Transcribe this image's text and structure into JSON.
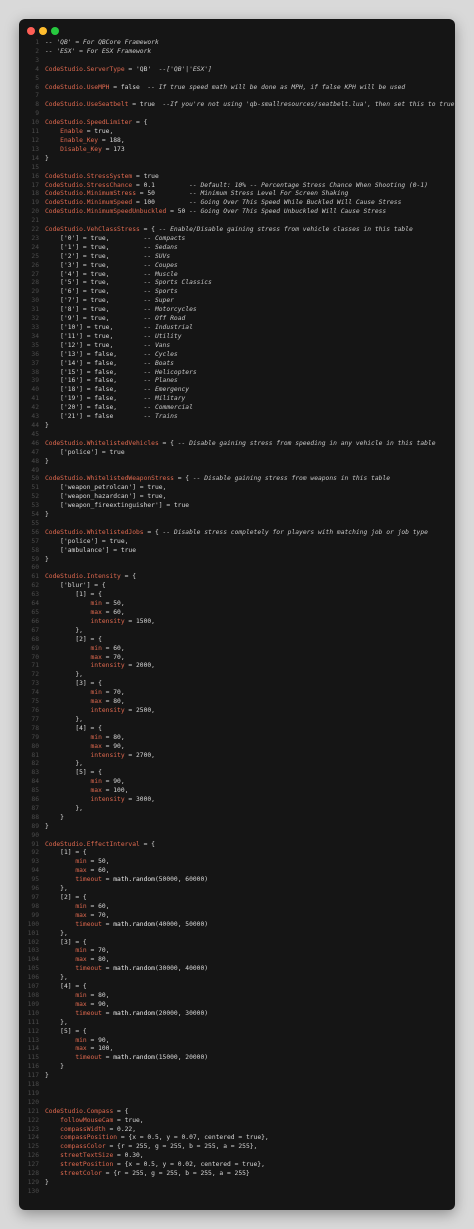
{
  "window_controls": [
    "close",
    "minimize",
    "maximize"
  ],
  "colors": {
    "keyword": "#e0694f",
    "comment": "#c8c8c8",
    "text": "#d8d8d8",
    "background": "#151515"
  },
  "code_lines": [
    [
      [
        "c",
        "-- 'QB' = For QBCore Framework"
      ]
    ],
    [
      [
        "c",
        "-- 'ESX' = For ESX Framework"
      ]
    ],
    [],
    [
      [
        "k",
        "CodeStudio.ServerType"
      ],
      [
        "t",
        " = 'QB'  "
      ],
      [
        "c",
        "--['QB'|'ESX']"
      ]
    ],
    [],
    [
      [
        "k",
        "CodeStudio.UseMPH"
      ],
      [
        "t",
        " = false  "
      ],
      [
        "c",
        "-- If true speed math will be done as MPH, if false KPH will be used"
      ]
    ],
    [],
    [
      [
        "k",
        "CodeStudio.UseSeatbelt"
      ],
      [
        "t",
        " = true  "
      ],
      [
        "c",
        "--If you're not using 'qb-smallresources/seatbelt.lua', then set this to true."
      ]
    ],
    [],
    [
      [
        "k",
        "CodeStudio.SpeedLimiter"
      ],
      [
        "t",
        " = {"
      ]
    ],
    [
      [
        "t",
        "    "
      ],
      [
        "k",
        "Enable"
      ],
      [
        "t",
        " = true,"
      ]
    ],
    [
      [
        "t",
        "    "
      ],
      [
        "k",
        "Enable_Key"
      ],
      [
        "t",
        " = 188,"
      ]
    ],
    [
      [
        "t",
        "    "
      ],
      [
        "k",
        "Disable_Key"
      ],
      [
        "t",
        " = 173"
      ]
    ],
    [
      [
        "t",
        "}"
      ]
    ],
    [],
    [
      [
        "k",
        "CodeStudio.StressSystem"
      ],
      [
        "t",
        " = true"
      ]
    ],
    [
      [
        "k",
        "CodeStudio.StressChance"
      ],
      [
        "t",
        " = 0.1         "
      ],
      [
        "c",
        "-- Default: 10% -- Percentage Stress Chance When Shooting (0-1)"
      ]
    ],
    [
      [
        "k",
        "CodeStudio.MinimumStress"
      ],
      [
        "t",
        " = 50         "
      ],
      [
        "c",
        "-- Minimum Stress Level For Screen Shaking"
      ]
    ],
    [
      [
        "k",
        "CodeStudio.MinimumSpeed"
      ],
      [
        "t",
        " = 100         "
      ],
      [
        "c",
        "-- Going Over This Speed While Buckled Will Cause Stress"
      ]
    ],
    [
      [
        "k",
        "CodeStudio.MinimumSpeedUnbuckled"
      ],
      [
        "t",
        " = 50 "
      ],
      [
        "c",
        "-- Going Over This Speed Unbuckled Will Cause Stress"
      ]
    ],
    [],
    [
      [
        "k",
        "CodeStudio.VehClassStress"
      ],
      [
        "t",
        " = { "
      ],
      [
        "c",
        "-- Enable/Disable gaining stress from vehicle classes in this table"
      ]
    ],
    [
      [
        "t",
        "    ['0'] = true,         "
      ],
      [
        "c",
        "-- Compacts"
      ]
    ],
    [
      [
        "t",
        "    ['1'] = true,         "
      ],
      [
        "c",
        "-- Sedans"
      ]
    ],
    [
      [
        "t",
        "    ['2'] = true,         "
      ],
      [
        "c",
        "-- SUVs"
      ]
    ],
    [
      [
        "t",
        "    ['3'] = true,         "
      ],
      [
        "c",
        "-- Coupes"
      ]
    ],
    [
      [
        "t",
        "    ['4'] = true,         "
      ],
      [
        "c",
        "-- Muscle"
      ]
    ],
    [
      [
        "t",
        "    ['5'] = true,         "
      ],
      [
        "c",
        "-- Sports Classics"
      ]
    ],
    [
      [
        "t",
        "    ['6'] = true,         "
      ],
      [
        "c",
        "-- Sports"
      ]
    ],
    [
      [
        "t",
        "    ['7'] = true,         "
      ],
      [
        "c",
        "-- Super"
      ]
    ],
    [
      [
        "t",
        "    ['8'] = true,         "
      ],
      [
        "c",
        "-- Motorcycles"
      ]
    ],
    [
      [
        "t",
        "    ['9'] = true,         "
      ],
      [
        "c",
        "-- Off Road"
      ]
    ],
    [
      [
        "t",
        "    ['10'] = true,        "
      ],
      [
        "c",
        "-- Industrial"
      ]
    ],
    [
      [
        "t",
        "    ['11'] = true,        "
      ],
      [
        "c",
        "-- Utility"
      ]
    ],
    [
      [
        "t",
        "    ['12'] = true,        "
      ],
      [
        "c",
        "-- Vans"
      ]
    ],
    [
      [
        "t",
        "    ['13'] = false,       "
      ],
      [
        "c",
        "-- Cycles"
      ]
    ],
    [
      [
        "t",
        "    ['14'] = false,       "
      ],
      [
        "c",
        "-- Boats"
      ]
    ],
    [
      [
        "t",
        "    ['15'] = false,       "
      ],
      [
        "c",
        "-- Helicopters"
      ]
    ],
    [
      [
        "t",
        "    ['16'] = false,       "
      ],
      [
        "c",
        "-- Planes"
      ]
    ],
    [
      [
        "t",
        "    ['18'] = false,       "
      ],
      [
        "c",
        "-- Emergency"
      ]
    ],
    [
      [
        "t",
        "    ['19'] = false,       "
      ],
      [
        "c",
        "-- Military"
      ]
    ],
    [
      [
        "t",
        "    ['20'] = false,       "
      ],
      [
        "c",
        "-- Commercial"
      ]
    ],
    [
      [
        "t",
        "    ['21'] = false        "
      ],
      [
        "c",
        "-- Trains"
      ]
    ],
    [
      [
        "t",
        "}"
      ]
    ],
    [],
    [
      [
        "k",
        "CodeStudio.WhitelistedVehicles"
      ],
      [
        "t",
        " = { "
      ],
      [
        "c",
        "-- Disable gaining stress from speeding in any vehicle in this table"
      ]
    ],
    [
      [
        "t",
        "    ['police'] = true"
      ]
    ],
    [
      [
        "t",
        "}"
      ]
    ],
    [],
    [
      [
        "k",
        "CodeStudio.WhitelistedWeaponStress"
      ],
      [
        "t",
        " = { "
      ],
      [
        "c",
        "-- Disable gaining stress from weapons in this table"
      ]
    ],
    [
      [
        "t",
        "    ['weapon_petrolcan'] = true,"
      ]
    ],
    [
      [
        "t",
        "    ['weapon_hazardcan'] = true,"
      ]
    ],
    [
      [
        "t",
        "    ['weapon_fireextinguisher'] = true"
      ]
    ],
    [
      [
        "t",
        "}"
      ]
    ],
    [],
    [
      [
        "k",
        "CodeStudio.WhitelistedJobs"
      ],
      [
        "t",
        " = { "
      ],
      [
        "c",
        "-- Disable stress completely for players with matching job or job type"
      ]
    ],
    [
      [
        "t",
        "    ['police'] = true,"
      ]
    ],
    [
      [
        "t",
        "    ['ambulance'] = true"
      ]
    ],
    [
      [
        "t",
        "}"
      ]
    ],
    [],
    [
      [
        "k",
        "CodeStudio.Intensity"
      ],
      [
        "t",
        " = {"
      ]
    ],
    [
      [
        "t",
        "    ['blur'] = {"
      ]
    ],
    [
      [
        "t",
        "        [1] = {"
      ]
    ],
    [
      [
        "t",
        "            "
      ],
      [
        "k",
        "min"
      ],
      [
        "t",
        " = 50,"
      ]
    ],
    [
      [
        "t",
        "            "
      ],
      [
        "k",
        "max"
      ],
      [
        "t",
        " = 60,"
      ]
    ],
    [
      [
        "t",
        "            "
      ],
      [
        "k",
        "intensity"
      ],
      [
        "t",
        " = 1500,"
      ]
    ],
    [
      [
        "t",
        "        },"
      ]
    ],
    [
      [
        "t",
        "        [2] = {"
      ]
    ],
    [
      [
        "t",
        "            "
      ],
      [
        "k",
        "min"
      ],
      [
        "t",
        " = 60,"
      ]
    ],
    [
      [
        "t",
        "            "
      ],
      [
        "k",
        "max"
      ],
      [
        "t",
        " = 70,"
      ]
    ],
    [
      [
        "t",
        "            "
      ],
      [
        "k",
        "intensity"
      ],
      [
        "t",
        " = 2000,"
      ]
    ],
    [
      [
        "t",
        "        },"
      ]
    ],
    [
      [
        "t",
        "        [3] = {"
      ]
    ],
    [
      [
        "t",
        "            "
      ],
      [
        "k",
        "min"
      ],
      [
        "t",
        " = 70,"
      ]
    ],
    [
      [
        "t",
        "            "
      ],
      [
        "k",
        "max"
      ],
      [
        "t",
        " = 80,"
      ]
    ],
    [
      [
        "t",
        "            "
      ],
      [
        "k",
        "intensity"
      ],
      [
        "t",
        " = 2500,"
      ]
    ],
    [
      [
        "t",
        "        },"
      ]
    ],
    [
      [
        "t",
        "        [4] = {"
      ]
    ],
    [
      [
        "t",
        "            "
      ],
      [
        "k",
        "min"
      ],
      [
        "t",
        " = 80,"
      ]
    ],
    [
      [
        "t",
        "            "
      ],
      [
        "k",
        "max"
      ],
      [
        "t",
        " = 90,"
      ]
    ],
    [
      [
        "t",
        "            "
      ],
      [
        "k",
        "intensity"
      ],
      [
        "t",
        " = 2700,"
      ]
    ],
    [
      [
        "t",
        "        },"
      ]
    ],
    [
      [
        "t",
        "        [5] = {"
      ]
    ],
    [
      [
        "t",
        "            "
      ],
      [
        "k",
        "min"
      ],
      [
        "t",
        " = 90,"
      ]
    ],
    [
      [
        "t",
        "            "
      ],
      [
        "k",
        "max"
      ],
      [
        "t",
        " = 100,"
      ]
    ],
    [
      [
        "t",
        "            "
      ],
      [
        "k",
        "intensity"
      ],
      [
        "t",
        " = 3000,"
      ]
    ],
    [
      [
        "t",
        "        },"
      ]
    ],
    [
      [
        "t",
        "    }"
      ]
    ],
    [
      [
        "t",
        "}"
      ]
    ],
    [],
    [
      [
        "k",
        "CodeStudio.EffectInterval"
      ],
      [
        "t",
        " = {"
      ]
    ],
    [
      [
        "t",
        "    [1] = {"
      ]
    ],
    [
      [
        "t",
        "        "
      ],
      [
        "k",
        "min"
      ],
      [
        "t",
        " = 50,"
      ]
    ],
    [
      [
        "t",
        "        "
      ],
      [
        "k",
        "max"
      ],
      [
        "t",
        " = 60,"
      ]
    ],
    [
      [
        "t",
        "        "
      ],
      [
        "k",
        "timeout"
      ],
      [
        "t",
        " = "
      ],
      [
        "f",
        "math.random"
      ],
      [
        "t",
        "(50000, 60000)"
      ]
    ],
    [
      [
        "t",
        "    },"
      ]
    ],
    [
      [
        "t",
        "    [2] = {"
      ]
    ],
    [
      [
        "t",
        "        "
      ],
      [
        "k",
        "min"
      ],
      [
        "t",
        " = 60,"
      ]
    ],
    [
      [
        "t",
        "        "
      ],
      [
        "k",
        "max"
      ],
      [
        "t",
        " = 70,"
      ]
    ],
    [
      [
        "t",
        "        "
      ],
      [
        "k",
        "timeout"
      ],
      [
        "t",
        " = "
      ],
      [
        "f",
        "math.random"
      ],
      [
        "t",
        "(40000, 50000)"
      ]
    ],
    [
      [
        "t",
        "    },"
      ]
    ],
    [
      [
        "t",
        "    [3] = {"
      ]
    ],
    [
      [
        "t",
        "        "
      ],
      [
        "k",
        "min"
      ],
      [
        "t",
        " = 70,"
      ]
    ],
    [
      [
        "t",
        "        "
      ],
      [
        "k",
        "max"
      ],
      [
        "t",
        " = 80,"
      ]
    ],
    [
      [
        "t",
        "        "
      ],
      [
        "k",
        "timeout"
      ],
      [
        "t",
        " = "
      ],
      [
        "f",
        "math.random"
      ],
      [
        "t",
        "(30000, 40000)"
      ]
    ],
    [
      [
        "t",
        "    },"
      ]
    ],
    [
      [
        "t",
        "    [4] = {"
      ]
    ],
    [
      [
        "t",
        "        "
      ],
      [
        "k",
        "min"
      ],
      [
        "t",
        " = 80,"
      ]
    ],
    [
      [
        "t",
        "        "
      ],
      [
        "k",
        "max"
      ],
      [
        "t",
        " = 90,"
      ]
    ],
    [
      [
        "t",
        "        "
      ],
      [
        "k",
        "timeout"
      ],
      [
        "t",
        " = "
      ],
      [
        "f",
        "math.random"
      ],
      [
        "t",
        "(20000, 30000)"
      ]
    ],
    [
      [
        "t",
        "    },"
      ]
    ],
    [
      [
        "t",
        "    [5] = {"
      ]
    ],
    [
      [
        "t",
        "        "
      ],
      [
        "k",
        "min"
      ],
      [
        "t",
        " = 90,"
      ]
    ],
    [
      [
        "t",
        "        "
      ],
      [
        "k",
        "max"
      ],
      [
        "t",
        " = 100,"
      ]
    ],
    [
      [
        "t",
        "        "
      ],
      [
        "k",
        "timeout"
      ],
      [
        "t",
        " = "
      ],
      [
        "f",
        "math.random"
      ],
      [
        "t",
        "(15000, 20000)"
      ]
    ],
    [
      [
        "t",
        "    }"
      ]
    ],
    [
      [
        "t",
        "}"
      ]
    ],
    [],
    [],
    [],
    [
      [
        "k",
        "CodeStudio.Compass"
      ],
      [
        "t",
        " = {"
      ]
    ],
    [
      [
        "t",
        "    "
      ],
      [
        "k",
        "followMouseCam"
      ],
      [
        "t",
        " = true,"
      ]
    ],
    [
      [
        "t",
        "    "
      ],
      [
        "k",
        "compassWidth"
      ],
      [
        "t",
        " = 0.22,"
      ]
    ],
    [
      [
        "t",
        "    "
      ],
      [
        "k",
        "compassPosition"
      ],
      [
        "t",
        " = {x = 0.5, y = 0.07, centered = true},"
      ]
    ],
    [
      [
        "t",
        "    "
      ],
      [
        "k",
        "compassColor"
      ],
      [
        "t",
        " = {r = 255, g = 255, b = 255, a = 255},"
      ]
    ],
    [
      [
        "t",
        "    "
      ],
      [
        "k",
        "streetTextSize"
      ],
      [
        "t",
        " = 0.30,"
      ]
    ],
    [
      [
        "t",
        "    "
      ],
      [
        "k",
        "streetPosition"
      ],
      [
        "t",
        " = {x = 0.5, y = 0.02, centered = true},"
      ]
    ],
    [
      [
        "t",
        "    "
      ],
      [
        "k",
        "streetColor"
      ],
      [
        "t",
        " = {r = 255, g = 255, b = 255, a = 255}"
      ]
    ],
    [
      [
        "t",
        "}"
      ]
    ],
    []
  ]
}
